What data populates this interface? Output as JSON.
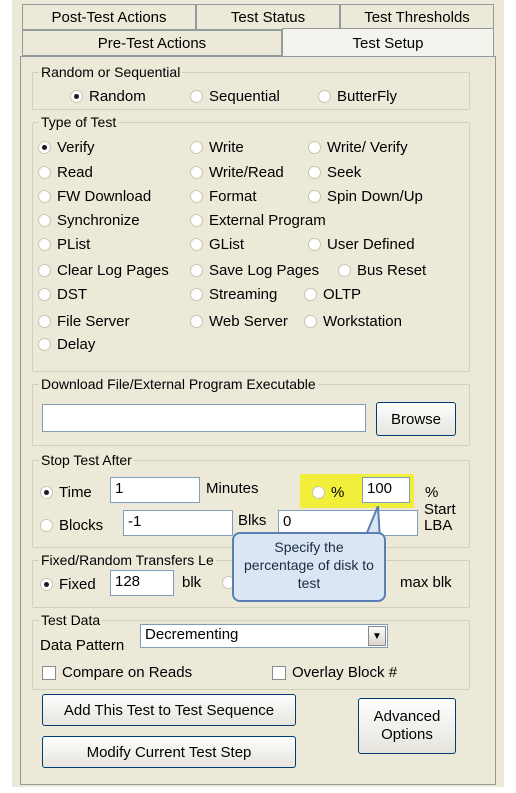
{
  "tabs": {
    "row1": [
      "Post-Test Actions",
      "Test Status",
      "Test Thresholds"
    ],
    "row2": [
      "Pre-Test Actions",
      "Test Setup"
    ]
  },
  "random_seq": {
    "legend": "Random or Sequential",
    "options": [
      "Random",
      "Sequential",
      "ButterFly"
    ],
    "selected": "Random"
  },
  "test_type": {
    "legend": "Type of Test",
    "options": [
      "Verify",
      "Write",
      "Write/ Verify",
      "Read",
      "Write/Read",
      "Seek",
      "FW Download",
      "Format",
      "Spin Down/Up",
      "Synchronize",
      "External Program",
      "PList",
      "GList",
      "User Defined",
      "Clear Log Pages",
      "Save Log Pages",
      "Bus Reset",
      "DST",
      "Streaming",
      "OLTP",
      "File Server",
      "Web Server",
      "Workstation",
      "Delay"
    ],
    "selected": "Verify"
  },
  "download": {
    "legend": "Download File/External Program Executable",
    "value": "",
    "browse": "Browse"
  },
  "stop": {
    "legend": "Stop Test After",
    "time_label": "Time",
    "time_value": "1",
    "minutes": "Minutes",
    "percent_label": "%",
    "percent_value": "100",
    "percent_unit": "%",
    "blocks_label": "Blocks",
    "blocks_value": "-1",
    "blks": "Blks",
    "lba_value": "0",
    "start_lba": "Start\nLBA"
  },
  "transfers": {
    "legend": "Fixed/Random Transfers Le",
    "fixed_label": "Fixed",
    "fixed_value": "128",
    "blk": "blk",
    "max_blk": "max blk"
  },
  "callout": {
    "text": "Specify the percentage of disk to test"
  },
  "test_data": {
    "legend": "Test Data",
    "pattern_label": "Data Pattern",
    "pattern_value": "Decrementing",
    "compare": "Compare on Reads",
    "overlay": "Overlay Block #"
  },
  "buttons": {
    "add": "Add This Test to Test Sequence",
    "modify": "Modify Current Test Step",
    "advanced": "Advanced Options"
  }
}
